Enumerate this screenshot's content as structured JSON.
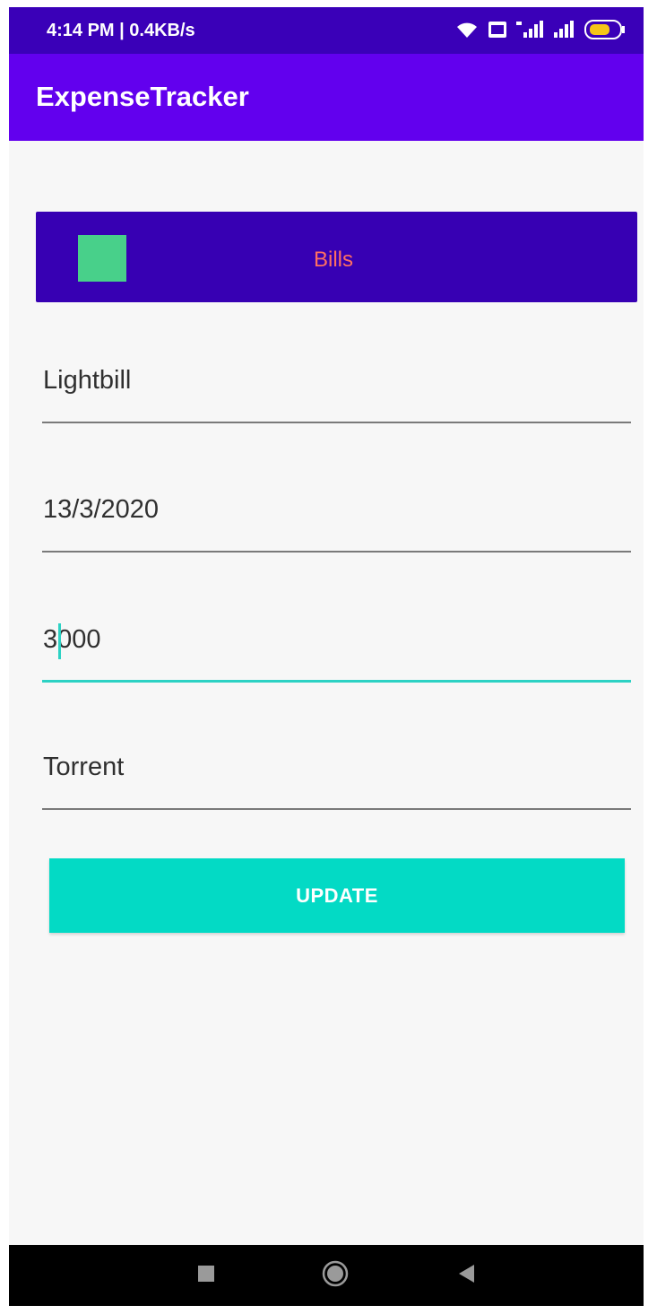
{
  "status_bar": {
    "time": "4:14 PM | 0.4KB/s",
    "icons": [
      "wifi-icon",
      "volte-icon",
      "signal-4g-icon",
      "signal-icon",
      "battery-icon"
    ],
    "battery_level": "58"
  },
  "app_bar": {
    "title": "ExpenseTracker"
  },
  "category": {
    "label": "Bills",
    "swatch_color": "#48d08a"
  },
  "form": {
    "name": "Lightbill",
    "date": "13/3/2020",
    "amount": "3000",
    "note": "Torrent"
  },
  "update_button": {
    "label": "UPDATE"
  },
  "nav": {
    "icons": [
      "recents-square-icon",
      "home-circle-icon",
      "back-triangle-icon"
    ]
  },
  "colors": {
    "primary": "#6200ee",
    "primary_dark": "#3700b3",
    "accent": "#03dac5"
  }
}
